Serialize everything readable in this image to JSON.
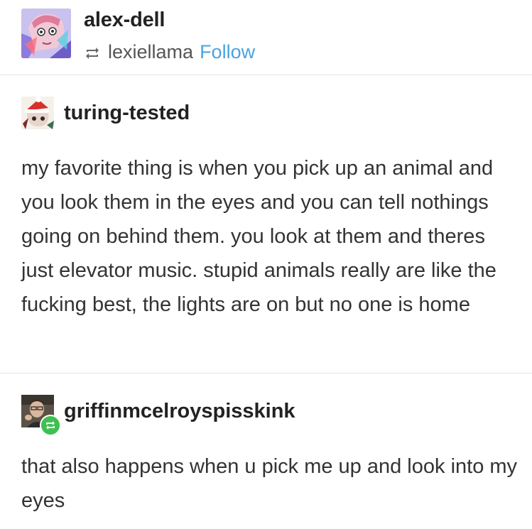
{
  "header": {
    "name": "alex-dell",
    "reblogged_from": "lexiellama",
    "follow_label": "Follow"
  },
  "posts": [
    {
      "username": "turing-tested",
      "text": "my favorite thing is when you pick up an animal and you look them in the eyes and you can tell nothings going on behind them. you look at them and theres just elevator music. stupid animals really are like the fucking best, the lights are on but no one is home"
    },
    {
      "username": "griffinmcelroyspisskink",
      "text": "that also happens when u pick me up and look into my eyes"
    }
  ],
  "colors": {
    "follow": "#4aa3df",
    "reblog_badge": "#3fbf52"
  },
  "icons": {
    "reblog": "reblog-icon"
  }
}
